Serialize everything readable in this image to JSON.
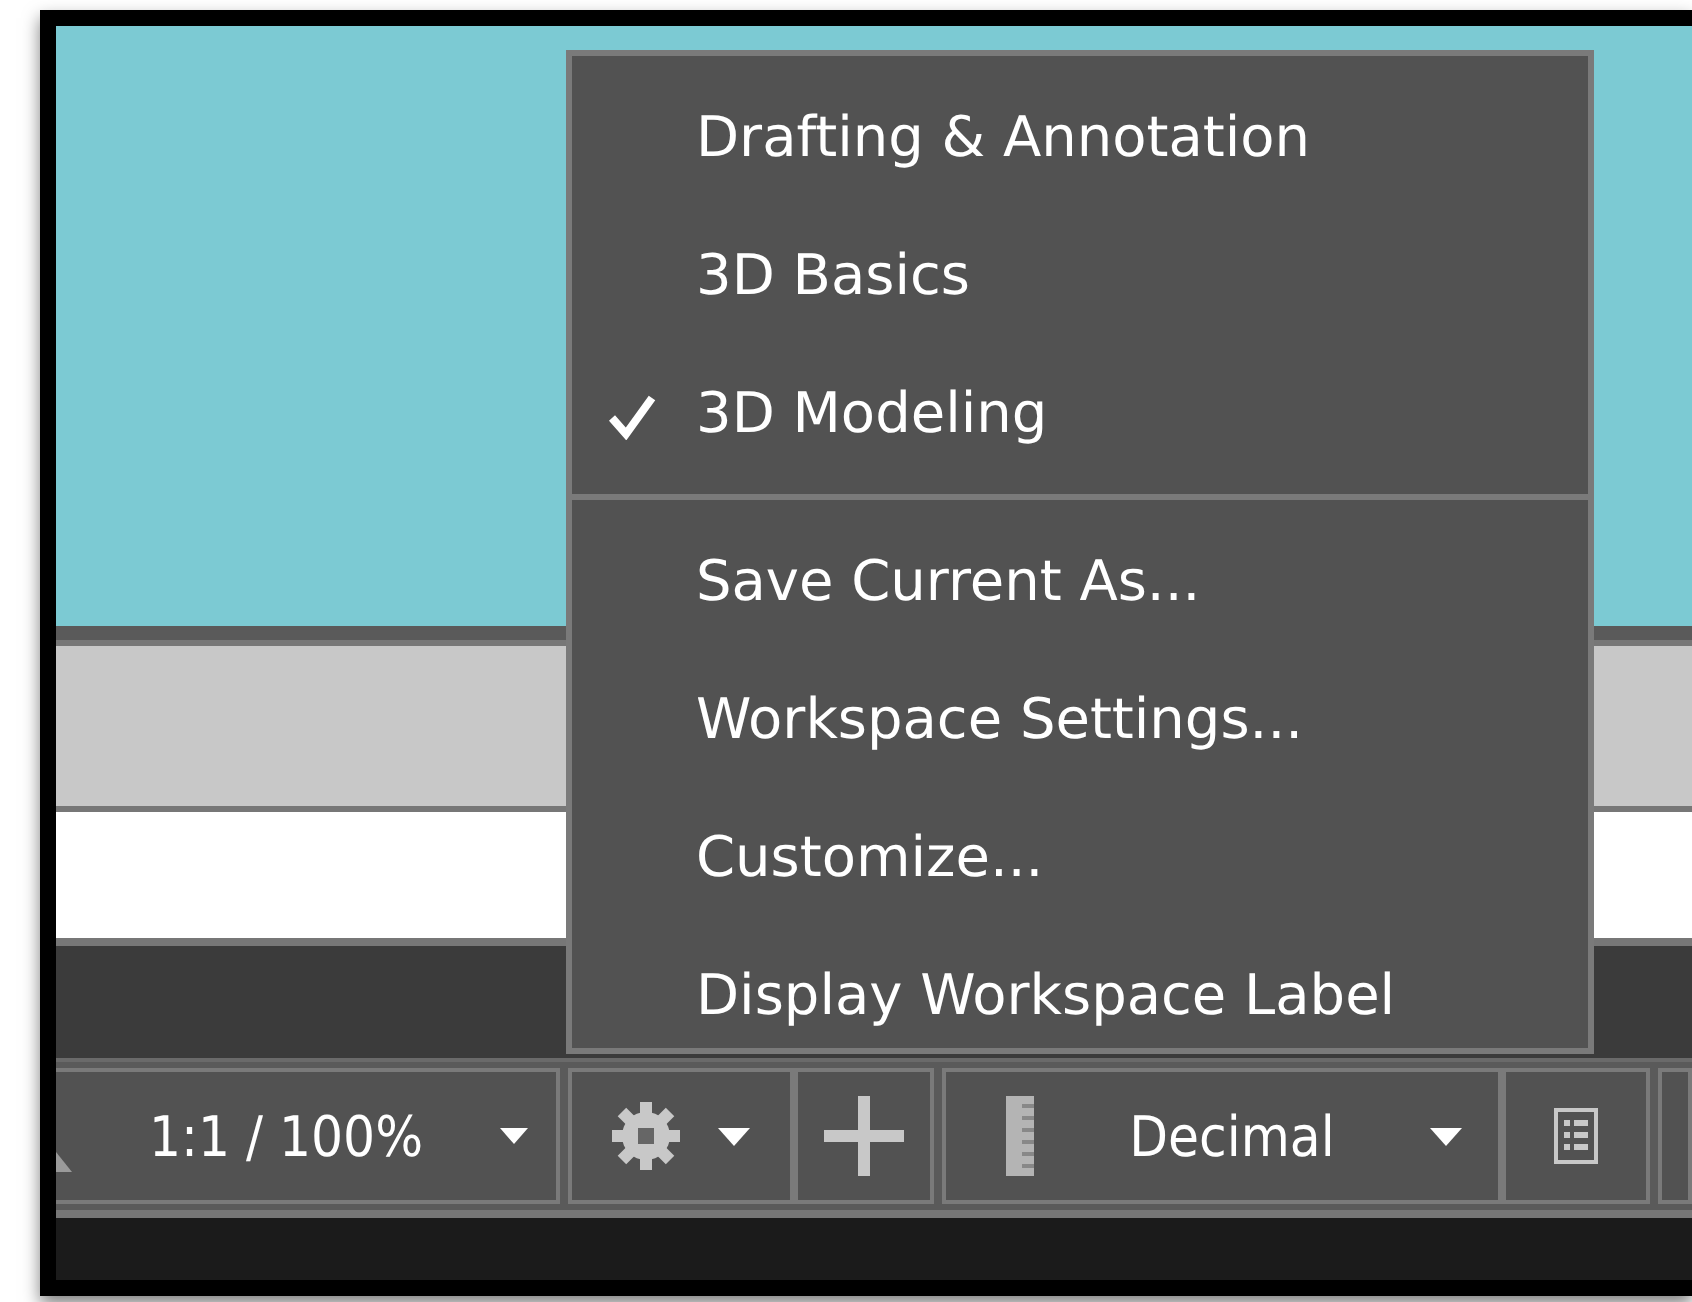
{
  "menu": {
    "sections": [
      {
        "items": [
          {
            "label": "Drafting & Annotation",
            "checked": false
          },
          {
            "label": "3D Basics",
            "checked": false
          },
          {
            "label": "3D Modeling",
            "checked": true
          }
        ]
      },
      {
        "items": [
          {
            "label": "Save Current As...",
            "checked": false
          },
          {
            "label": "Workspace Settings...",
            "checked": false
          },
          {
            "label": "Customize...",
            "checked": false
          },
          {
            "label": "Display Workspace Label",
            "checked": false
          }
        ]
      }
    ]
  },
  "status_bar": {
    "scale": "1:1 / 100%",
    "units": "Decimal"
  }
}
